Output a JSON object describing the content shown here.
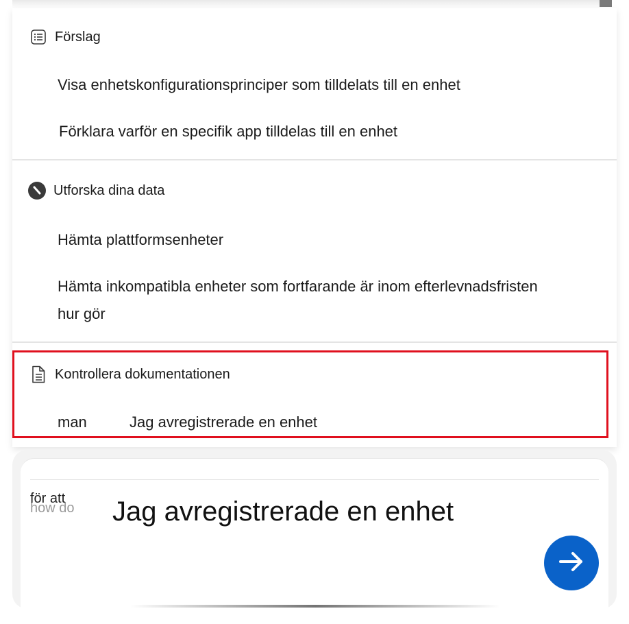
{
  "sections": {
    "suggestions": {
      "title": "Förslag",
      "icon": "list-icon",
      "items": [
        "Visa enhetskonfigurationsprinciper som tilldelats till en enhet",
        "Förklara varför en specifik app tilldelas till en enhet"
      ]
    },
    "explore": {
      "title": "Utforska dina data",
      "icon": "compass-icon",
      "items": [
        "Hämta plattformsenheter",
        "Hämta inkompatibla enheter som fortfarande är inom efterlevnadsfristen",
        "hur gör"
      ]
    },
    "docs": {
      "title": "Kontrollera dokumentationen",
      "icon": "document-icon",
      "item_prefix": "man",
      "item_text": "Jag avregistrerade en enhet"
    }
  },
  "composer": {
    "ghost_text": "för att",
    "ghost_behind": "how do",
    "input_text": "Jag avregistrerade en enhet",
    "send_icon": "arrow-right-icon",
    "accent_color": "#0a62c9"
  },
  "highlight_color": "#e0101e"
}
